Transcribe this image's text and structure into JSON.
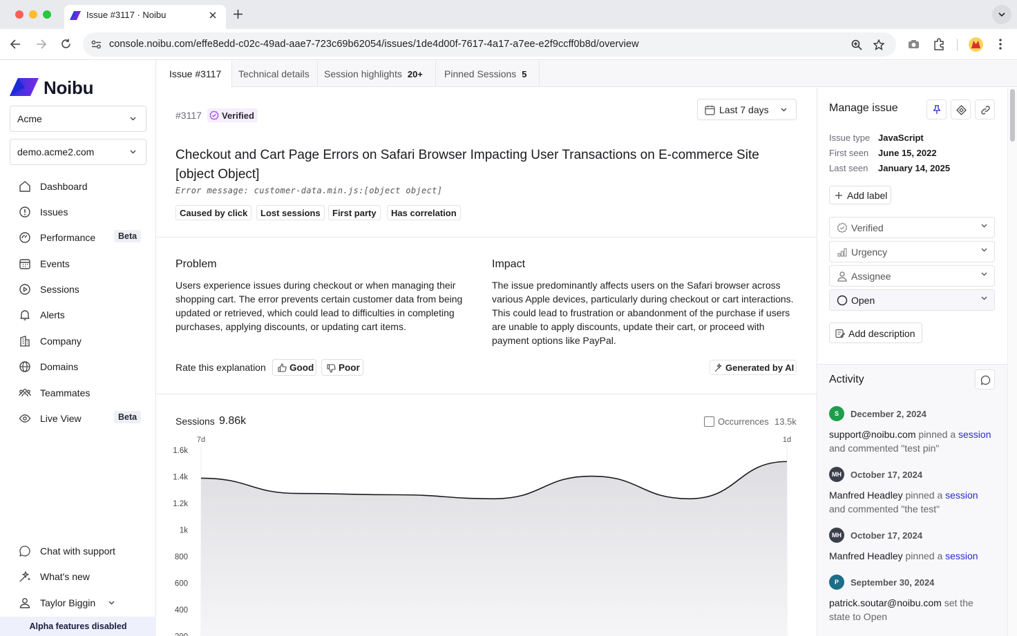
{
  "browser": {
    "tab_title": "Issue #3117 · Noibu",
    "url": "console.noibu.com/effe8edd-c02c-49ad-aae7-723c69b62054/issues/1de4d00f-7617-4a17-a7ee-e2f9ccff0b8d/overview"
  },
  "sidebar": {
    "brand": "Noibu",
    "org_select": "Acme",
    "domain_select": "demo.acme2.com",
    "nav": [
      {
        "label": "Dashboard",
        "icon": "home-icon"
      },
      {
        "label": "Issues",
        "icon": "alert-circle-icon"
      },
      {
        "label": "Performance",
        "icon": "gauge-icon",
        "badge": "Beta"
      },
      {
        "label": "Events",
        "icon": "calendar-grid-icon"
      },
      {
        "label": "Sessions",
        "icon": "play-circle-icon"
      },
      {
        "label": "Alerts",
        "icon": "bell-icon"
      },
      {
        "label": "Company",
        "icon": "building-icon"
      },
      {
        "label": "Domains",
        "icon": "globe-icon"
      },
      {
        "label": "Teammates",
        "icon": "people-icon"
      },
      {
        "label": "Live View",
        "icon": "eye-icon",
        "badge": "Beta"
      }
    ],
    "bottom": [
      {
        "label": "Chat with support",
        "icon": "chat-icon"
      },
      {
        "label": "What's new",
        "icon": "sparkle-icon"
      },
      {
        "label": "Taylor Biggin",
        "icon": "user-icon"
      }
    ],
    "alpha_banner": "Alpha features disabled"
  },
  "page_tabs": [
    {
      "label": "Issue #3117",
      "count": ""
    },
    {
      "label": "Technical details",
      "count": ""
    },
    {
      "label": "Session highlights",
      "count": "20+"
    },
    {
      "label": "Pinned Sessions",
      "count": "5"
    }
  ],
  "issue": {
    "number": "#3117",
    "verified": "Verified",
    "date_range": "Last 7 days",
    "title_line1": "Checkout and Cart Page Errors on Safari Browser Impacting User Transactions on E-commerce Site",
    "title_line2": "[object Object]",
    "error_message": "Error message: customer-data.min.js:[object object]",
    "tags": [
      "Caused by click",
      "Lost sessions",
      "First party",
      "Has correlation"
    ]
  },
  "explanation": {
    "problem_title": "Problem",
    "problem_text": "Users experience issues during checkout or when managing their shopping cart. The error prevents certain customer data from being updated or retrieved, which could lead to difficulties in completing purchases, applying discounts, or updating cart items.",
    "impact_title": "Impact",
    "impact_text": "The issue predominantly affects users on the Safari browser across various Apple devices, particularly during checkout or cart interactions. This could lead to frustration or abandonment of the purchase if users are unable to apply discounts, update their cart, or proceed with payment options like PayPal.",
    "rate_label": "Rate this explanation",
    "good": "Good",
    "poor": "Poor",
    "generated": "Generated by AI"
  },
  "sessions_panel": {
    "label": "Sessions",
    "value": "9.86k",
    "occurrences_label": "Occurrences",
    "occurrences_value": "13.5k"
  },
  "chart_data": {
    "type": "area",
    "x": [
      "7d",
      "6d",
      "5d",
      "4d",
      "3d",
      "2d",
      "1d"
    ],
    "x_tick_labels": [
      "7d",
      "1d"
    ],
    "values": [
      1390,
      1275,
      1265,
      1235,
      1405,
      1235,
      1515
    ],
    "ylim": [
      200,
      1600
    ],
    "y_ticks": [
      "1.6k",
      "1.4k",
      "1.2k",
      "1k",
      "800",
      "600",
      "400",
      "200"
    ],
    "grid": false,
    "line_color": "#1b1b1f",
    "fill_color": "#e4e4e7"
  },
  "manage": {
    "title": "Manage issue",
    "meta": [
      {
        "key": "Issue type",
        "value": "JavaScript"
      },
      {
        "key": "First seen",
        "value": "June 15, 2022"
      },
      {
        "key": "Last seen",
        "value": "January 14, 2025"
      }
    ],
    "add_label": "Add label",
    "dropdowns": [
      {
        "label": "Verified",
        "icon": "verified-badge-icon"
      },
      {
        "label": "Urgency",
        "icon": "signal-bars-icon"
      },
      {
        "label": "Assignee",
        "icon": "user-icon"
      },
      {
        "label": "Open",
        "icon": "open-circle-icon"
      }
    ],
    "add_description": "Add description"
  },
  "activity": {
    "title": "Activity",
    "items": [
      {
        "initials": "S",
        "color": "#1e9e4a",
        "date": "December 2, 2024",
        "who": "support@noibu.com",
        "t1": " pinned a ",
        "link": "session",
        "t2": " and commented \"test pin\""
      },
      {
        "initials": "MH",
        "color": "#3a3f4b",
        "date": "October 17, 2024",
        "who": "Manfred Headley",
        "t1": " pinned a ",
        "link": "session",
        "t2": " and commented \"the test\""
      },
      {
        "initials": "MH",
        "color": "#3a3f4b",
        "date": "October 17, 2024",
        "who": "Manfred Headley",
        "t1": " pinned a ",
        "link": "session",
        "t2": ""
      },
      {
        "initials": "P",
        "color": "#1b6d8a",
        "date": "September 30, 2024",
        "who": "patrick.soutar@noibu.com",
        "t1": " set the state to Open",
        "link": "",
        "t2": ""
      }
    ]
  }
}
